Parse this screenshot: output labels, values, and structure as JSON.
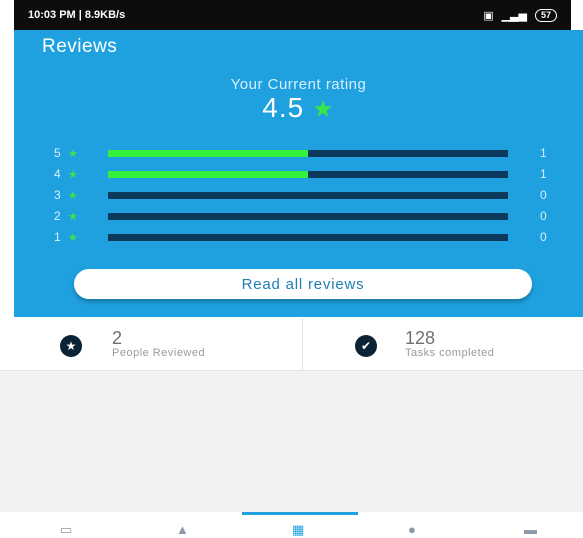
{
  "status_bar": {
    "left_text": "10:03 PM | 8.9KB/s",
    "battery": "57"
  },
  "header": {
    "title": "Reviews",
    "rating_caption": "Your Current rating",
    "rating_value": "4.5"
  },
  "rating_bars": [
    {
      "label": "5",
      "fraction": 0.5,
      "count": "1"
    },
    {
      "label": "4",
      "fraction": 0.5,
      "count": "1"
    },
    {
      "label": "3",
      "fraction": 0.0,
      "count": "0"
    },
    {
      "label": "2",
      "fraction": 0.0,
      "count": "0"
    },
    {
      "label": "1",
      "fraction": 0.0,
      "count": "0"
    }
  ],
  "read_all_label": "Read all reviews",
  "stats": {
    "people_reviewed": {
      "value": "2",
      "label": "People Reviewed"
    },
    "tasks_completed": {
      "value": "128",
      "label": "Tasks completed"
    }
  },
  "bottom_nav": [
    {
      "icon": "calendar-icon",
      "active": false
    },
    {
      "icon": "bell-icon",
      "active": false
    },
    {
      "icon": "grid-icon",
      "active": true
    },
    {
      "icon": "person-icon",
      "active": false
    },
    {
      "icon": "chat-icon",
      "active": false
    }
  ],
  "colors": {
    "header_bg": "#1fa1df",
    "bar_fill": "#35f03c",
    "bar_track": "#0b3a5c",
    "star": "#35e64a"
  }
}
